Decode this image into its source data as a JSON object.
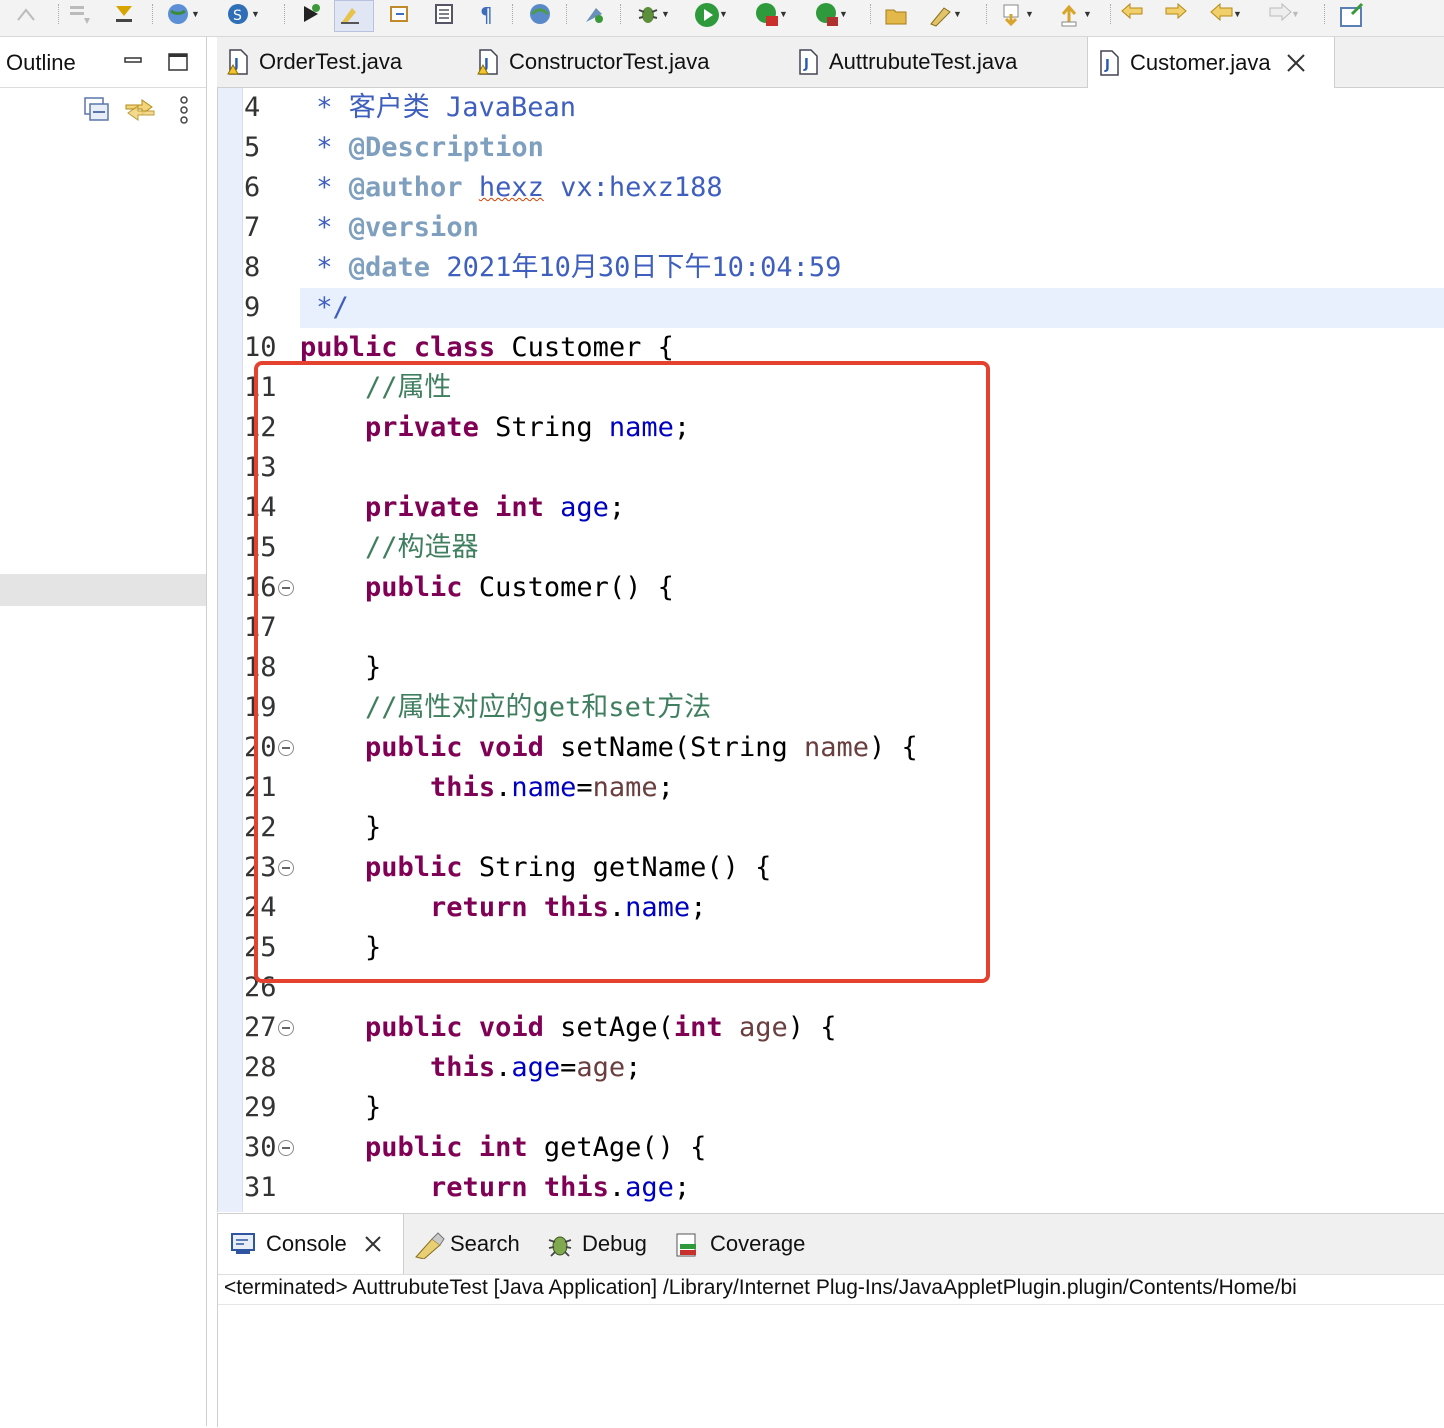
{
  "outline": {
    "title": "Outline"
  },
  "tabs": [
    {
      "label": "OrderTest.java"
    },
    {
      "label": "ConstructorTest.java"
    },
    {
      "label": "AuttrubuteTest.java"
    },
    {
      "label": "Customer.java"
    }
  ],
  "code_lines": [
    {
      "n": "4",
      "parts": [
        [
          "doc",
          " * 客户类 JavaBean"
        ]
      ]
    },
    {
      "n": "5",
      "parts": [
        [
          "doc",
          " * "
        ],
        [
          "tag",
          "@Description"
        ]
      ]
    },
    {
      "n": "6",
      "parts": [
        [
          "doc",
          " * "
        ],
        [
          "tag",
          "@author"
        ],
        [
          "doc",
          " "
        ],
        [
          "squig",
          "hexz"
        ],
        [
          "doc",
          " vx:hexz188"
        ]
      ]
    },
    {
      "n": "7",
      "parts": [
        [
          "doc",
          " * "
        ],
        [
          "tag",
          "@version"
        ]
      ]
    },
    {
      "n": "8",
      "parts": [
        [
          "doc",
          " * "
        ],
        [
          "tag",
          "@date"
        ],
        [
          "doc",
          " 2021年10月30日下午10:04:59"
        ]
      ]
    },
    {
      "n": "9",
      "parts": [
        [
          "doc",
          " */"
        ]
      ]
    },
    {
      "n": "10",
      "parts": [
        [
          "kw",
          "public"
        ],
        [
          "pl",
          " "
        ],
        [
          "kw",
          "class"
        ],
        [
          "pl",
          " Customer {"
        ]
      ]
    },
    {
      "n": "11",
      "parts": [
        [
          "pl",
          "    "
        ],
        [
          "cm",
          "//属性"
        ]
      ]
    },
    {
      "n": "12",
      "parts": [
        [
          "pl",
          "    "
        ],
        [
          "kw",
          "private"
        ],
        [
          "pl",
          " String "
        ],
        [
          "fld",
          "name"
        ],
        [
          "pl",
          ";"
        ]
      ]
    },
    {
      "n": "13",
      "parts": [
        [
          "pl",
          ""
        ]
      ]
    },
    {
      "n": "14",
      "parts": [
        [
          "pl",
          "    "
        ],
        [
          "kw",
          "private"
        ],
        [
          "pl",
          " "
        ],
        [
          "kw",
          "int"
        ],
        [
          "pl",
          " "
        ],
        [
          "fld",
          "age"
        ],
        [
          "pl",
          ";"
        ]
      ]
    },
    {
      "n": "15",
      "parts": [
        [
          "pl",
          "    "
        ],
        [
          "cm",
          "//构造器"
        ]
      ]
    },
    {
      "n": "16",
      "parts": [
        [
          "pl",
          "    "
        ],
        [
          "kw",
          "public"
        ],
        [
          "pl",
          " Customer() {"
        ]
      ],
      "fold": true
    },
    {
      "n": "17",
      "parts": [
        [
          "pl",
          ""
        ]
      ]
    },
    {
      "n": "18",
      "parts": [
        [
          "pl",
          "    }"
        ]
      ]
    },
    {
      "n": "19",
      "parts": [
        [
          "pl",
          "    "
        ],
        [
          "cm",
          "//属性对应的get和set方法"
        ]
      ]
    },
    {
      "n": "20",
      "parts": [
        [
          "pl",
          "    "
        ],
        [
          "kw",
          "public"
        ],
        [
          "pl",
          " "
        ],
        [
          "kw",
          "void"
        ],
        [
          "pl",
          " setName(String "
        ],
        [
          "par",
          "name"
        ],
        [
          "pl",
          ") {"
        ]
      ],
      "fold": true
    },
    {
      "n": "21",
      "parts": [
        [
          "pl",
          "        "
        ],
        [
          "kw",
          "this"
        ],
        [
          "pl",
          "."
        ],
        [
          "fld",
          "name"
        ],
        [
          "pl",
          "="
        ],
        [
          "par",
          "name"
        ],
        [
          "pl",
          ";"
        ]
      ]
    },
    {
      "n": "22",
      "parts": [
        [
          "pl",
          "    }"
        ]
      ]
    },
    {
      "n": "23",
      "parts": [
        [
          "pl",
          "    "
        ],
        [
          "kw",
          "public"
        ],
        [
          "pl",
          " String getName() {"
        ]
      ],
      "fold": true
    },
    {
      "n": "24",
      "parts": [
        [
          "pl",
          "        "
        ],
        [
          "kw",
          "return"
        ],
        [
          "pl",
          " "
        ],
        [
          "kw",
          "this"
        ],
        [
          "pl",
          "."
        ],
        [
          "fld",
          "name"
        ],
        [
          "pl",
          ";"
        ]
      ]
    },
    {
      "n": "25",
      "parts": [
        [
          "pl",
          "    }"
        ]
      ]
    },
    {
      "n": "26",
      "parts": [
        [
          "pl",
          ""
        ]
      ]
    },
    {
      "n": "27",
      "parts": [
        [
          "pl",
          "    "
        ],
        [
          "kw",
          "public"
        ],
        [
          "pl",
          " "
        ],
        [
          "kw",
          "void"
        ],
        [
          "pl",
          " setAge("
        ],
        [
          "kw",
          "int"
        ],
        [
          "pl",
          " "
        ],
        [
          "par",
          "age"
        ],
        [
          "pl",
          ") {"
        ]
      ],
      "fold": true
    },
    {
      "n": "28",
      "parts": [
        [
          "pl",
          "        "
        ],
        [
          "kw",
          "this"
        ],
        [
          "pl",
          "."
        ],
        [
          "fld",
          "age"
        ],
        [
          "pl",
          "="
        ],
        [
          "par",
          "age"
        ],
        [
          "pl",
          ";"
        ]
      ]
    },
    {
      "n": "29",
      "parts": [
        [
          "pl",
          "    }"
        ]
      ]
    },
    {
      "n": "30",
      "parts": [
        [
          "pl",
          "    "
        ],
        [
          "kw",
          "public"
        ],
        [
          "pl",
          " "
        ],
        [
          "kw",
          "int"
        ],
        [
          "pl",
          " getAge() {"
        ]
      ],
      "fold": true
    },
    {
      "n": "31",
      "parts": [
        [
          "pl",
          "        "
        ],
        [
          "kw",
          "return"
        ],
        [
          "pl",
          " "
        ],
        [
          "kw",
          "this"
        ],
        [
          "pl",
          "."
        ],
        [
          "fld",
          "age"
        ],
        [
          "pl",
          ";"
        ]
      ]
    }
  ],
  "console": {
    "tabs": [
      {
        "label": "Console"
      },
      {
        "label": "Search"
      },
      {
        "label": "Debug"
      },
      {
        "label": "Coverage"
      }
    ],
    "status_line": "<terminated> AuttrubuteTest [Java Application] /Library/Internet Plug-Ins/JavaAppletPlugin.plugin/Contents/Home/bi"
  },
  "icons": {
    "toolbar": [
      "refactor-icon",
      "next-annotation-icon",
      "toggle-mark-icon",
      "web-browser-icon",
      "new-server-icon",
      "run-last-icon",
      "toggle-highlight-icon",
      "open-declaration-icon",
      "show-whitespace-icon",
      "globe-icon",
      "external-tools-icon",
      "debug-icon",
      "run-icon",
      "coverage-run-icon",
      "profile-run-icon",
      "open-folder-icon",
      "search-icon",
      "next-edit-icon",
      "previous-edit-icon",
      "back-icon",
      "forward-icon",
      "navigate-back-icon",
      "navigate-forward-icon",
      "pin-icon"
    ],
    "colors": {
      "keyword": "#7f0055",
      "javadoc": "#3f5fbf",
      "javadoc_tag": "#7f9fbf",
      "comment": "#3f7f5f",
      "field": "#0000c0",
      "parameter": "#6a3e3e",
      "annotation_box": "#e5412f",
      "current_line": "#e8f0fd"
    }
  }
}
